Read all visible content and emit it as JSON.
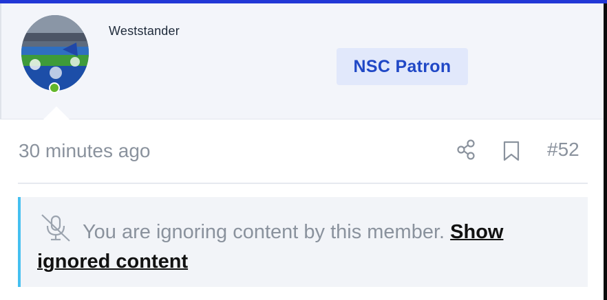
{
  "user": {
    "username": "Weststander",
    "badge": "NSC Patron",
    "status": "online"
  },
  "post": {
    "timestamp": "30 minutes ago",
    "number": "#52"
  },
  "ignored": {
    "message": "You are ignoring content by this member.",
    "link": "Show ignored content"
  },
  "icons": {
    "share": "share-icon",
    "bookmark": "bookmark-icon",
    "muted": "microphone-muted-icon"
  },
  "colors": {
    "accent": "#2137d6",
    "badge_bg": "#e1e8fb",
    "badge_text": "#2048c6",
    "online": "#63b72b",
    "notice_border": "#45c0f0",
    "muted_text": "#8a929d"
  }
}
